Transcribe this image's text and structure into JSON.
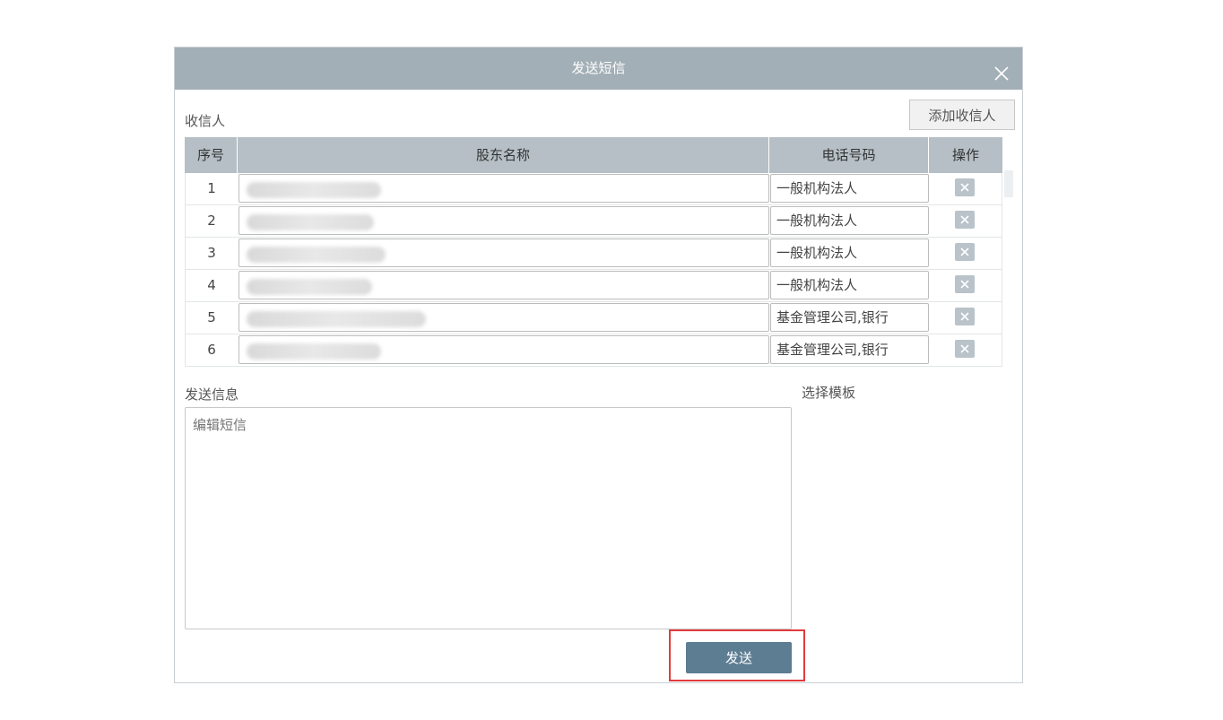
{
  "dialog": {
    "title": "发送短信",
    "recipients_label": "收信人",
    "add_recipient_button": "添加收信人",
    "table": {
      "headers": [
        "序号",
        "股东名称",
        "电话号码",
        "操作"
      ],
      "rows": [
        {
          "index": "1",
          "name": "",
          "phone": "一般机构法人"
        },
        {
          "index": "2",
          "name": "",
          "phone": "一般机构法人"
        },
        {
          "index": "3",
          "name": "",
          "phone": "一般机构法人"
        },
        {
          "index": "4",
          "name": "",
          "phone": "一般机构法人"
        },
        {
          "index": "5",
          "name": "",
          "phone": "基金管理公司,银行"
        },
        {
          "index": "6",
          "name": "",
          "phone": "基金管理公司,银行"
        }
      ]
    },
    "message_label": "发送信息",
    "message_placeholder": "编辑短信",
    "template_label": "选择模板",
    "send_button": "发送"
  },
  "colors": {
    "titlebar": "#a3afb6",
    "table_header": "#b5bfc5",
    "send_button": "#5d7d93",
    "highlight": "#e23b3b"
  }
}
